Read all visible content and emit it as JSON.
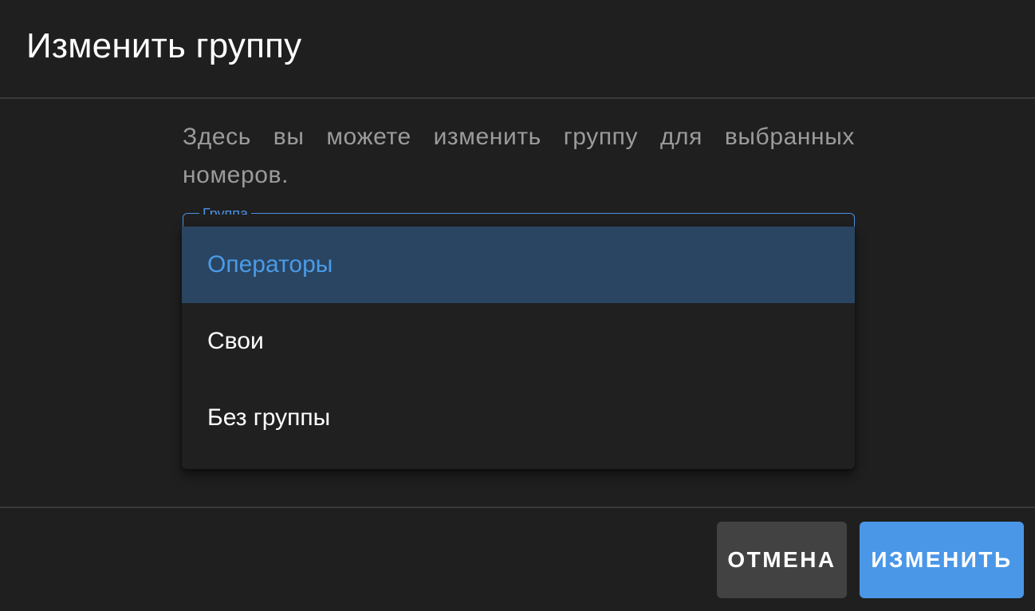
{
  "dialog": {
    "title": "Изменить группу",
    "description": "Здесь вы можете изменить группу для выбранных номеров.",
    "select": {
      "label": "Группа",
      "options": [
        "Операторы",
        "Свои",
        "Без группы"
      ],
      "selected_index": 0
    },
    "buttons": {
      "cancel_label": "ОТМЕНА",
      "submit_label": "ИЗМЕНИТЬ"
    }
  },
  "colors": {
    "background": "#1f1f1f",
    "accent": "#4a97e8",
    "selected_bg": "#2a4561",
    "cancel_bg": "#424242"
  }
}
